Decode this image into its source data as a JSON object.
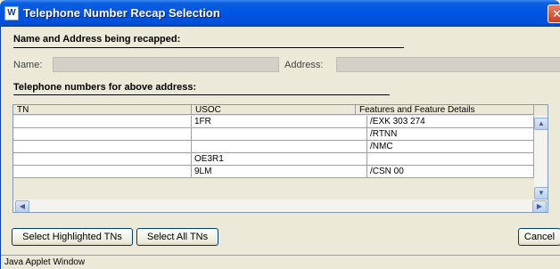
{
  "window": {
    "title": "Telephone Number Recap Selection",
    "app_icon_text": "W",
    "close_symbol": "✕"
  },
  "name_section": {
    "heading": "Name and Address being recapped:",
    "name_label": "Name:",
    "name_value": "",
    "address_label": "Address:",
    "address_value": ""
  },
  "tn_section": {
    "heading": "Telephone numbers for above address:"
  },
  "table": {
    "columns": [
      "TN",
      "USOC",
      "Features and Feature Details"
    ],
    "rows": [
      [
        "",
        "1FR",
        "/EXK 303 274"
      ],
      [
        "",
        "",
        "/RTNN"
      ],
      [
        "",
        "",
        "/NMC"
      ],
      [
        "",
        "OE3R1",
        ""
      ],
      [
        "",
        "9LM",
        "/CSN 00"
      ]
    ]
  },
  "scroll": {
    "up": "▲",
    "down": "▼",
    "left": "◀",
    "right": "▶"
  },
  "buttons": {
    "select_highlighted": "Select Highlighted TNs",
    "select_all": "Select All TNs",
    "cancel": "Cancel"
  },
  "status": "Java Applet Window",
  "colors": {
    "title_bar": "#0054e3",
    "window_bg": "#ece9d8",
    "close_button": "#c8401e"
  }
}
